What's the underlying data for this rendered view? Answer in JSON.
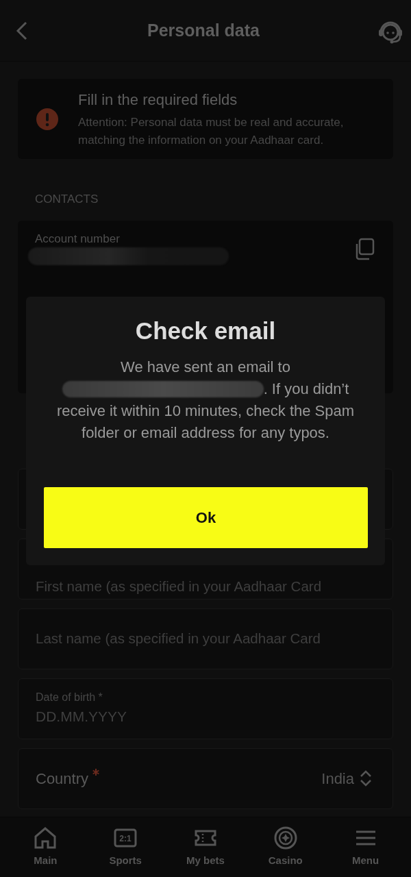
{
  "header": {
    "title": "Personal data"
  },
  "alert": {
    "title": "Fill in the required fields",
    "text": "Attention: Personal data must be real and accurate, matching the information on your Aadhaar card."
  },
  "section_label": "CONTACTS",
  "account": {
    "label": "Account number"
  },
  "fields": [
    {
      "kind": "text",
      "placeholder": "First name (as specified in your Aadhaar Card"
    },
    {
      "kind": "text",
      "placeholder": "Last name (as specified in your Aadhaar Card"
    },
    {
      "kind": "date",
      "label": "Date of birth *",
      "placeholder": "DD.MM.YYYY"
    },
    {
      "kind": "select",
      "label": "Country",
      "required": true,
      "value": "India"
    }
  ],
  "modal": {
    "title": "Check email",
    "text_before": "We have sent an email to",
    "text_after_email": ". If you didn’t",
    "text_rest": "receive it within 10 minutes, check the Spam folder or email address for any typos.",
    "button": "Ok"
  },
  "nav": [
    {
      "kind": "home",
      "label": "Main"
    },
    {
      "kind": "score",
      "icon_text": "2:1",
      "label": "Sports"
    },
    {
      "kind": "ticket",
      "label": "My bets"
    },
    {
      "kind": "chip",
      "label": "Casino"
    },
    {
      "kind": "menu",
      "label": "Menu"
    }
  ]
}
